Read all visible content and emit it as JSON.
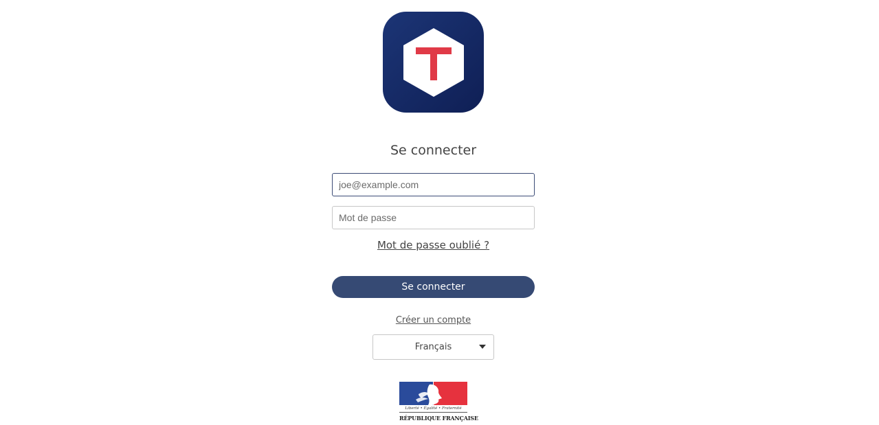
{
  "app": {
    "logo_letter": "T",
    "logo_colors": {
      "background": "#1c3576",
      "hexagon": "#ffffff",
      "letter": "#e03a47"
    }
  },
  "login": {
    "title": "Se connecter",
    "email_placeholder": "joe@example.com",
    "password_placeholder": "Mot de passe",
    "forgot_password_label": "Mot de passe oublié ?",
    "submit_label": "Se connecter",
    "create_account_label": "Créer un compte"
  },
  "language": {
    "selected": "Français"
  },
  "footer": {
    "motto": "Liberté • Égalité • Fraternité",
    "republic_name": "RÉPUBLIQUE FRANÇAISE"
  },
  "colors": {
    "primary_button": "#364a74",
    "flag_blue": "#2a4b9b",
    "flag_red": "#e6323e"
  }
}
